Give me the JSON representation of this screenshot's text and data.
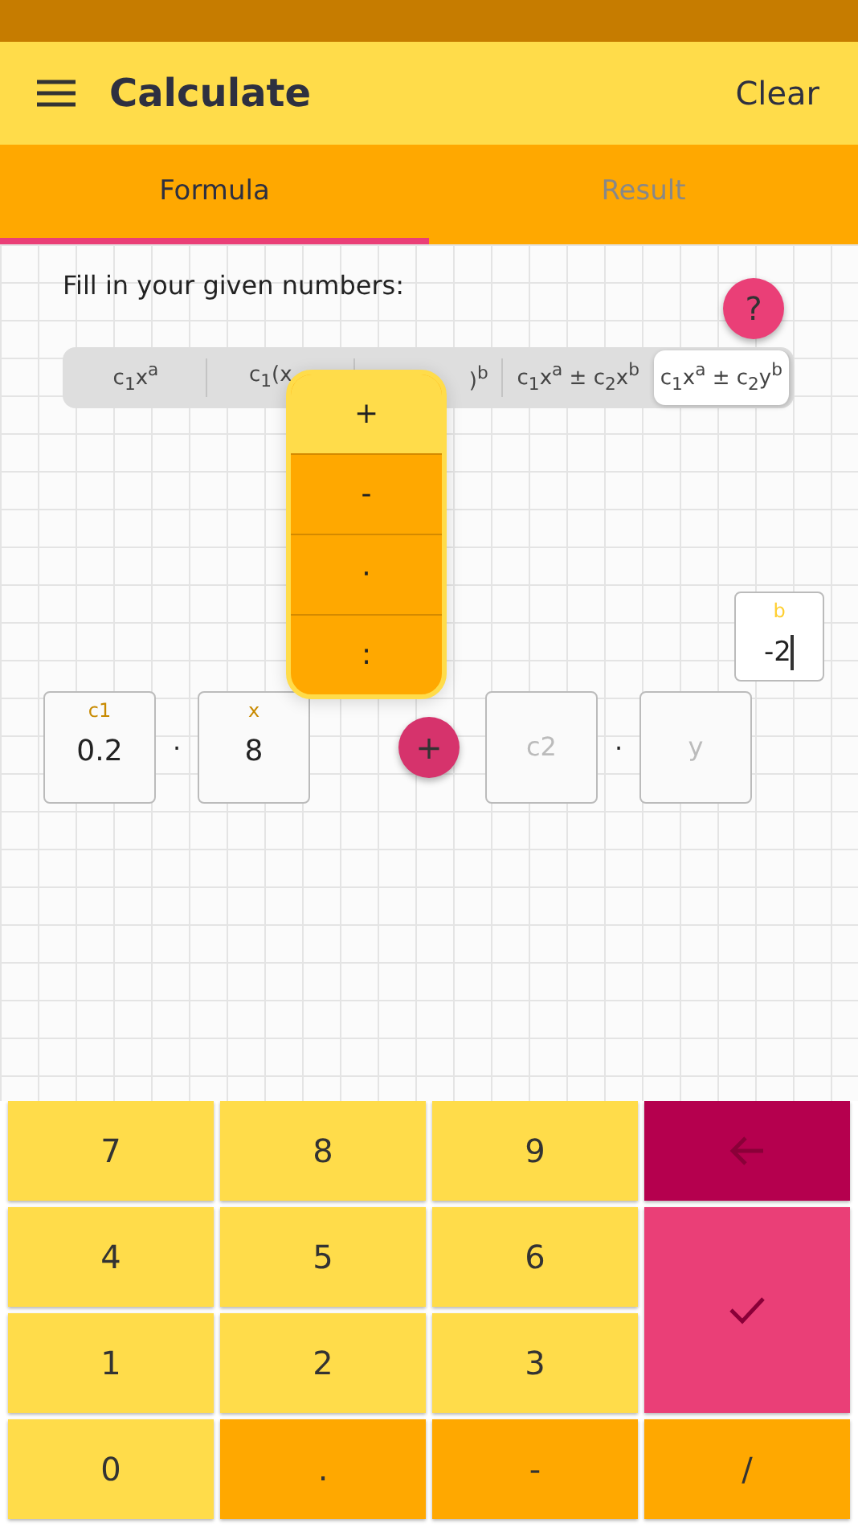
{
  "app_bar": {
    "title": "Calculate",
    "action": "Clear"
  },
  "tabs": [
    {
      "label": "Formula",
      "selected": true
    },
    {
      "label": "Result",
      "selected": false
    }
  ],
  "prompt": "Fill in your given numbers:",
  "help_button": "?",
  "formula_types": [
    {
      "label": "c$_{1}$x$^{a}$",
      "selected": false
    },
    {
      "label": "c$_{1}$(x",
      "selected": false
    },
    {
      "label": ")$^{b}$",
      "selected": false
    },
    {
      "label": "c$_{1}$x$^{a}$ ± c$_{2}$x$^{b}$",
      "selected": false
    },
    {
      "label": "c$_{1}$x$^{a}$ ± c$_{2}$y$^{b}$",
      "selected": true
    }
  ],
  "operator_menu": [
    {
      "label": "+",
      "selected": true
    },
    {
      "label": "-",
      "selected": false
    },
    {
      "label": "·",
      "selected": false
    },
    {
      "label": ":",
      "selected": false
    }
  ],
  "exponent_field": {
    "label": "b",
    "value": "-2",
    "focused": true
  },
  "fields": [
    {
      "kind": "field",
      "label": "c1",
      "value": "0.2"
    },
    {
      "kind": "times",
      "label": "·"
    },
    {
      "kind": "field",
      "label": "x",
      "value": "8"
    },
    {
      "kind": "operator",
      "label": "+"
    },
    {
      "kind": "field",
      "placeholder": "c2"
    },
    {
      "kind": "times",
      "label": "·"
    },
    {
      "kind": "field",
      "placeholder": "y"
    }
  ],
  "keypad": [
    {
      "kind": "digit",
      "label": "7"
    },
    {
      "kind": "digit",
      "label": "8"
    },
    {
      "kind": "digit",
      "label": "9"
    },
    {
      "kind": "backspace"
    },
    {
      "kind": "digit",
      "label": "4"
    },
    {
      "kind": "digit",
      "label": "5"
    },
    {
      "kind": "digit",
      "label": "6"
    },
    {
      "kind": "enter"
    },
    {
      "kind": "digit",
      "label": "1"
    },
    {
      "kind": "digit",
      "label": "2"
    },
    {
      "kind": "digit",
      "label": "3"
    },
    {
      "kind": "digit",
      "label": "0"
    },
    {
      "kind": "symbol",
      "label": "."
    },
    {
      "kind": "symbol",
      "label": "-"
    },
    {
      "kind": "symbol",
      "label": "/"
    }
  ]
}
